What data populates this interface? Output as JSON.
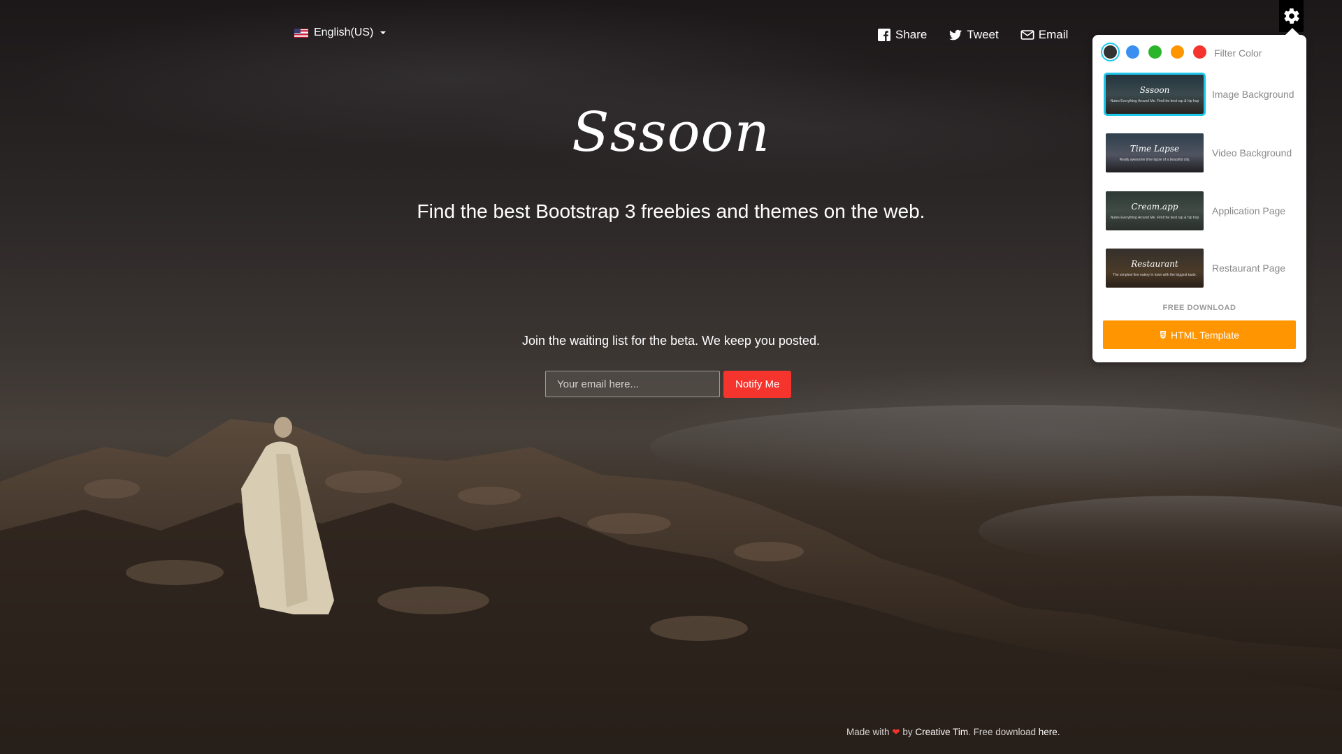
{
  "header": {
    "language": "English(US)",
    "share": [
      {
        "label": "Share",
        "icon": "facebook-icon"
      },
      {
        "label": "Tweet",
        "icon": "twitter-icon"
      },
      {
        "label": "Email",
        "icon": "envelope-icon"
      }
    ]
  },
  "main": {
    "logo": "Sssoon",
    "tagline": "Find the best Bootstrap 3 freebies and themes on the web.",
    "waiting_text": "Join the waiting list for the beta. We keep you posted.",
    "email_placeholder": "Your email here...",
    "notify_label": "Notify Me"
  },
  "footer": {
    "made_with": "Made with",
    "heart": "❤",
    "by": "by",
    "author": "Creative Tim",
    "free_download": ". Free download",
    "here": "here."
  },
  "settings": {
    "filter_label": "Filter Color",
    "colors": [
      "#333333",
      "#3a8ff0",
      "#2bb52b",
      "#ff9500",
      "#f5352d"
    ],
    "selected_color": "#333333",
    "themes": [
      {
        "label": "Image Background",
        "thumb_title": "Sssoon",
        "thumb_sub": "Nutes Everything Around Me. Find the best rap & hip hop",
        "selected": true
      },
      {
        "label": "Video Background",
        "thumb_title": "Time Lapse",
        "thumb_sub": "Really awesome time lapse of a beautiful city.",
        "selected": false
      },
      {
        "label": "Application Page",
        "thumb_title": "Cream.app",
        "thumb_sub": "Nutes Everything Around Me. Find the best rap & hip hop",
        "selected": false
      },
      {
        "label": "Restaurant Page",
        "thumb_title": "Restaurant",
        "thumb_sub": "The simplest fine eatery in town with the biggest taste.",
        "selected": false
      }
    ],
    "free_download": "FREE DOWNLOAD",
    "html_template": "HTML Template",
    "accent": "#1dc7ea",
    "button_color": "#ff9500"
  }
}
